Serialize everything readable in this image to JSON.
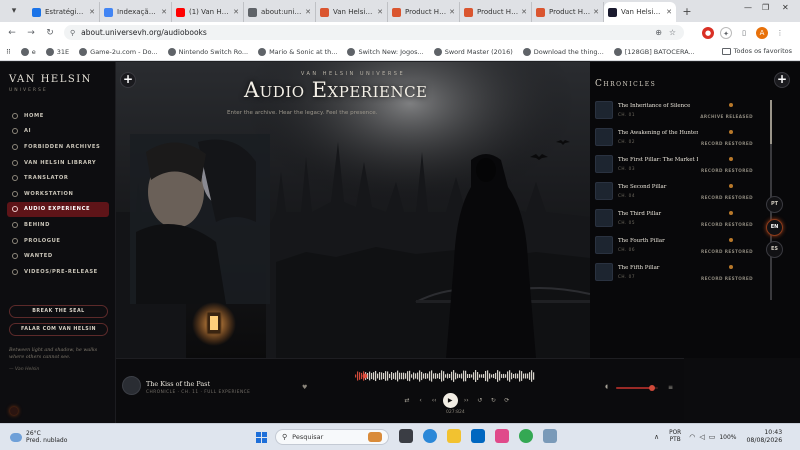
{
  "browser": {
    "tabs": [
      {
        "label": "Estratégia de",
        "color": "#1a73e8"
      },
      {
        "label": "Indexação de",
        "color": "#4285f4"
      },
      {
        "label": "(1) Van Helsin",
        "color": "#ff0000"
      },
      {
        "label": "about:univers",
        "color": "#5f6368"
      },
      {
        "label": "Van Helsin. V",
        "color": "#da552f"
      },
      {
        "label": "Product Hunt",
        "color": "#da552f"
      },
      {
        "label": "Product Hunt",
        "color": "#da552f"
      },
      {
        "label": "Product Hunt",
        "color": "#da552f"
      },
      {
        "label": "Van Helsin. C",
        "color": "#1a1a2e"
      }
    ],
    "new_tab": "+",
    "url": "about.universevh.org/audiobooks",
    "bookmarks": [
      "e",
      "31E",
      "Game-2u.com - Do...",
      "Nintendo Switch Ro...",
      "Mario & Sonic at th...",
      "Switch New: Jogos...",
      "Sword Master (2016)",
      "Download the thing...",
      "[128GB] BATOCERA..."
    ],
    "bookmarks_right": "Todos os favoritos",
    "profile_initial": "A"
  },
  "sidebar": {
    "logo": "VAN HELSIN",
    "logo_sub": "UNIVERSE",
    "nav": [
      "HOME",
      "AI",
      "FORBIDDEN ARCHIVES",
      "VAN HELSIN LIBRARY",
      "TRANSLATOR",
      "WORKSTATION",
      "AUDIO EXPERIENCE",
      "BEHIND",
      "PROLOGUE",
      "WANTED",
      "VIDEOS/PRE-RELEASE"
    ],
    "active_nav": "AUDIO EXPERIENCE",
    "btn_deal": "BREAK THE SEAL",
    "btn_contact": "FALAR COM VAN HELSIN",
    "quote": "Between light and shadow, he walks where others cannot see.",
    "quote_author": "— Van Helsin"
  },
  "hero": {
    "kicker": "VAN HELSIN UNIVERSE",
    "title": "Audio Experience",
    "subtitle": "Enter the archive. Hear the legacy. Feel the presence."
  },
  "chronicles": {
    "title": "Chronicles",
    "items": [
      {
        "title": "The Inheritance of Silence",
        "num": "CH. 01",
        "status": "ARCHIVE RELEASED"
      },
      {
        "title": "The Awakening of the Hunter",
        "num": "CH. 02",
        "status": "RECORD RESTORED"
      },
      {
        "title": "The First Pillar: The Market Is N...",
        "num": "CH. 03",
        "status": "RECORD RESTORED"
      },
      {
        "title": "The Second Pillar",
        "num": "CH. 04",
        "status": "RECORD RESTORED"
      },
      {
        "title": "The Third Pillar",
        "num": "CH. 05",
        "status": "RECORD RESTORED"
      },
      {
        "title": "The Fourth Pillar",
        "num": "CH. 06",
        "status": "RECORD RESTORED"
      },
      {
        "title": "The Fifth Pillar",
        "num": "CH. 07",
        "status": "RECORD RESTORED"
      }
    ],
    "languages": [
      "PT",
      "EN",
      "ES"
    ],
    "active_language": "EN"
  },
  "player": {
    "title": "The Kiss of the Past",
    "subtitle": "CHRONICLE · CH. 11 · FULL EXPERIENCE",
    "time": "027:824",
    "volume": 0.85
  },
  "taskbar": {
    "temp": "26°C",
    "weather": "Pred. nublado",
    "search": "Pesquisar",
    "lang1": "POR",
    "lang2": "PTB",
    "battery": "100%",
    "time": "10:43",
    "date": "08/08/2026"
  },
  "colors": {
    "accent": "#5e1418",
    "page_bg": "#0c0c0e"
  }
}
